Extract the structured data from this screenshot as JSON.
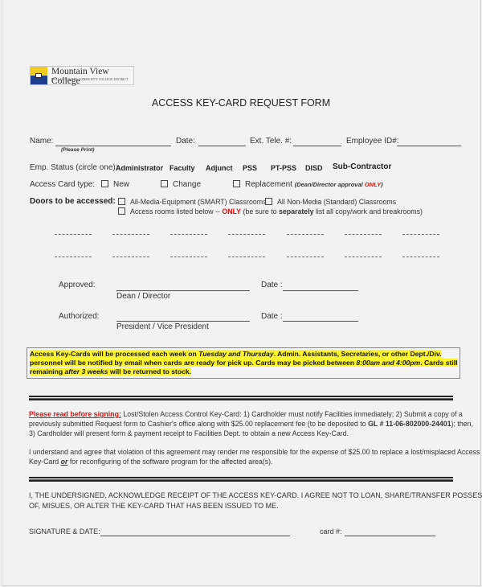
{
  "header": {
    "college_name": "Mountain View College",
    "district_name": "DALLAS COUNTY COMMUNITY COLLEGE DISTRICT",
    "form_title": "ACCESS KEY-CARD REQUEST FORM"
  },
  "fields": {
    "name_label": "Name:",
    "name_hint": "(Please Print)",
    "date_label": "Date:",
    "ext_label": "Ext. Tele. #:",
    "employee_id_label": "Employee ID#:"
  },
  "emp_status": {
    "label": "Emp. Status (circle one):",
    "options": [
      "Administrator",
      "Faculty",
      "Adjunct",
      "PSS",
      "PT-PSS",
      "DISD",
      "Sub-Contractor"
    ]
  },
  "card_type": {
    "label": "Access Card type:",
    "options": [
      "New",
      "Change",
      "Replacement"
    ],
    "replacement_note_prefix": "(Dean/Director approval ",
    "replacement_note_emph": "ONLY",
    "replacement_note_suffix": ")"
  },
  "doors": {
    "label": "Doors to be accessed:",
    "option_smart": "All-Media-Equipment (SMART) Classrooms",
    "option_nonmedia": "All Non-Media (Standard) Classrooms",
    "option_listed_prefix": "Access rooms listed below -- ",
    "option_listed_emph": "ONLY",
    "option_listed_mid": " (be sure to ",
    "option_listed_bold": "separately",
    "option_listed_suffix": " list all copy/work and breakrooms)"
  },
  "approvals": {
    "approved_label": "Approved:",
    "approved_role": "Dean / Director",
    "authorized_label": "Authorized:",
    "authorized_role": "President / Vice President",
    "date_label": "Date :"
  },
  "notice": {
    "l1a": "Access Key-Cards will be processed each week on ",
    "l1b": "Tuesday and Thursday",
    "l1c": ".  Admin. Assistants, Secretaries, or other Dept./Div. designated",
    "l2a": "personnel will be notified by email when cards are ready for pick up.  Cards may be picked between ",
    "l2b": "8:00am and 4:00pm",
    "l2c": ".   Cards still",
    "l3a": "remaining ",
    "l3b": "after 3 weeks",
    "l3c": " will be returned to stock."
  },
  "lost_card": {
    "warning": "Please read before signing:",
    "l1": "  Lost/Stolen Access Control Key-Card:  1) Cardholder must notify Facilities immediately; 2) Submit a copy of a",
    "l2a": "previously submitted Request form to Cashier's office along with $25.00 replacement fee (to be deposited to ",
    "l2b": "GL # 11-06-802000-24401",
    "l2c": "); then,",
    "l3": "3) Cardholder will present form & payment receipt to Facilities Dept. to obtain a new Access Key-Card."
  },
  "agreement": {
    "l1": "I understand and agree that violation of this agreement may render me responsible for the expense of $25.00 to replace a lost/misplaced Access",
    "l2a": "Key-Card    ",
    "l2b": "or",
    "l2c": "   for reconfiguring of the software program for the affected area(s)."
  },
  "acknowledgement": {
    "l1": "I, THE UNDERSIGNED, ACKNOWLEDGE RECEIPT OF THE ACCESS KEY-CARD.  I AGREE NOT TO LOAN, SHARE/TRANSFER POSSESSION",
    "l2": "OF, MISUES, OR ALTER THE KEY-CARD THAT HAS BEEN ISSUED TO ME."
  },
  "signature": {
    "signature_label": "SIGNATURE & DATE:",
    "card_label": "card #:"
  },
  "colors": {
    "highlight": "#fff52a",
    "warning_red": "#d11111",
    "logo_yellow": "#f2c91c",
    "logo_blue": "#1e3f8f"
  }
}
